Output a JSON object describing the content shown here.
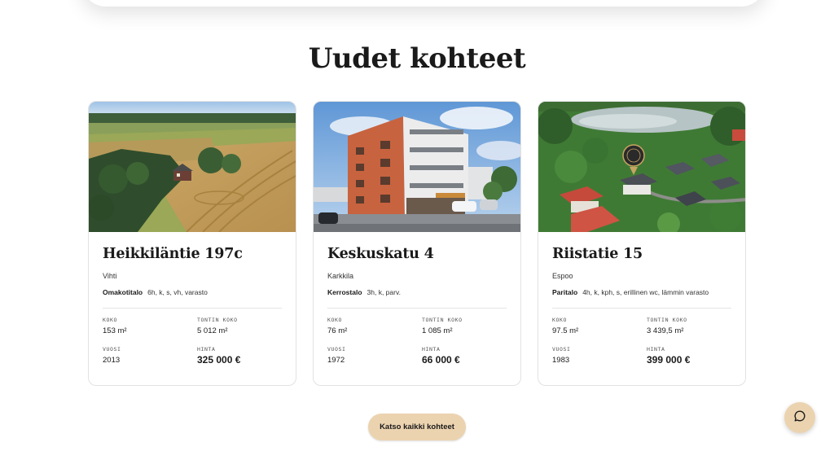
{
  "section": {
    "title": "Uudet kohteet"
  },
  "labels": {
    "size": "KOKO",
    "lot_size": "TONTIN KOKO",
    "year": "VUOSI",
    "price": "HINTA"
  },
  "listings": [
    {
      "title": "Heikkiläntie 197c",
      "city": "Vihti",
      "type": "Omakotitalo",
      "rooms": "6h, k, s, vh, varasto",
      "size": "153 m²",
      "lot_size": "5 012 m²",
      "year": "2013",
      "price": "325 000 €"
    },
    {
      "title": "Keskuskatu 4",
      "city": "Karkkila",
      "type": "Kerrostalo",
      "rooms": "3h, k, parv.",
      "size": "76 m²",
      "lot_size": "1 085 m²",
      "year": "1972",
      "price": "66 000 €"
    },
    {
      "title": "Riistatie 15",
      "city": "Espoo",
      "type": "Paritalo",
      "rooms": "4h, k, kph, s, erillinen wc, lämmin varasto",
      "size": "97.5 m²",
      "lot_size": "3 439,5 m²",
      "year": "1983",
      "price": "399 000 €"
    }
  ],
  "cta": {
    "label": "Katso kaikki kohteet"
  },
  "icons": {
    "chat": "chat-bubble-icon"
  },
  "colors": {
    "accent": "#ecd3b0",
    "text": "#1a1a1a"
  }
}
